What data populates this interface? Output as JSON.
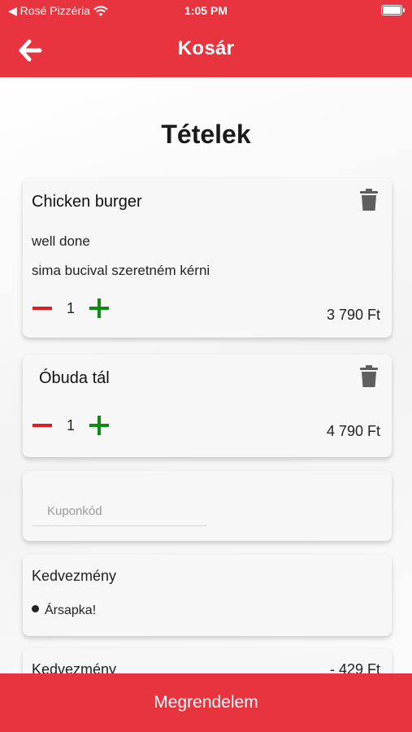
{
  "status_bar": {
    "back_app": "◀ Rosé Pizzéria",
    "time": "1:05 PM"
  },
  "header": {
    "title": "Kosár",
    "accent_color": "#e8343f"
  },
  "page_title": "Tételek",
  "items": [
    {
      "name": "Chicken burger",
      "notes": [
        "well done",
        "sima bucival szeretném kérni"
      ],
      "quantity": "1",
      "price": "3 790 Ft"
    },
    {
      "name": "Óbuda tál",
      "notes": [],
      "quantity": "1",
      "price": "4 790 Ft"
    }
  ],
  "coupon": {
    "placeholder": "Kuponkód",
    "value": ""
  },
  "discount_card": {
    "title": "Kedvezmény",
    "items": [
      "Ársapka!"
    ]
  },
  "summary": {
    "label": "Kedvezmény",
    "value": "- 429 Ft"
  },
  "order_button": "Megrendelem",
  "icons": {
    "back": "arrow-left-icon",
    "delete": "trash-icon",
    "decrease": "minus-icon",
    "increase": "plus-icon"
  }
}
